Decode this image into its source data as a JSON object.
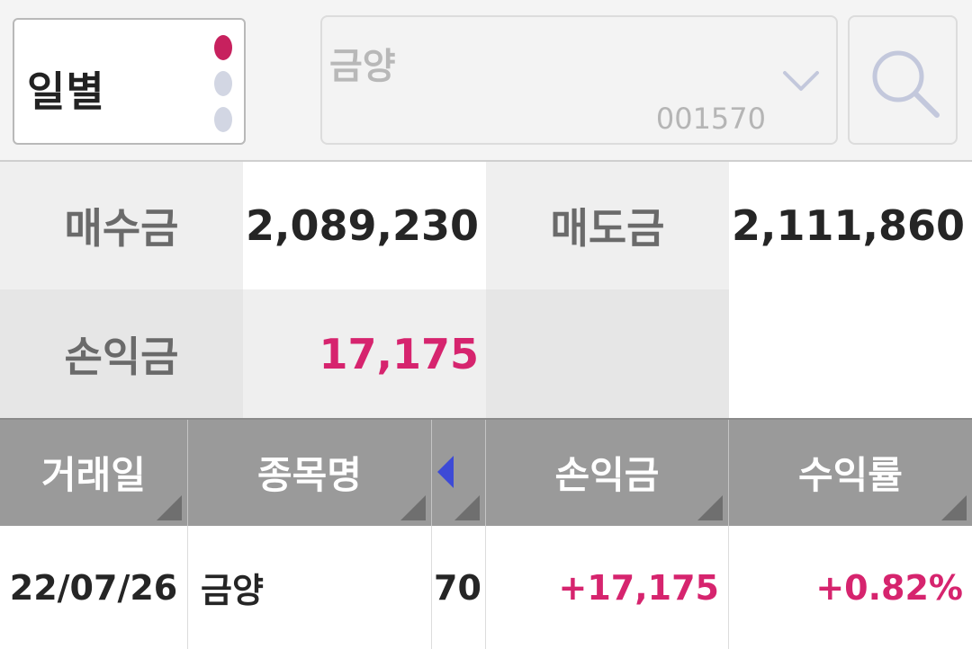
{
  "top": {
    "period_label": "일별",
    "stock_name": "금양",
    "stock_code": "001570"
  },
  "summary": {
    "buy_label": "매수금",
    "buy_value": "2,089,230",
    "sell_label": "매도금",
    "sell_value": "2,111,860",
    "profit_label": "손익금",
    "profit_value": "17,175"
  },
  "table": {
    "headers": [
      "거래일",
      "종목명",
      "",
      "손익금",
      "수익률"
    ],
    "rows": [
      {
        "date": "22/07/26",
        "name": "금양",
        "qty": "70",
        "profit": "+17,175",
        "rate": "+0.82%"
      }
    ]
  },
  "icons": {
    "dropdown": "chevron-down-icon",
    "search": "search-icon",
    "scroll_left": "triangle-left-icon"
  },
  "colors": {
    "accent_pink": "#d6246e",
    "dot_active": "#c7215e",
    "header_bg": "#9a9a9a",
    "left_arrow": "#3d4ad6"
  }
}
